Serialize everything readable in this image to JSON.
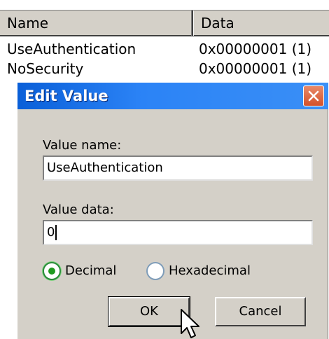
{
  "list": {
    "columns": [
      "Name",
      "Data"
    ],
    "rows": [
      {
        "name": "UseAuthentication",
        "data": "0x00000001 (1)"
      },
      {
        "name": "NoSecurity",
        "data": "0x00000001 (1)"
      }
    ]
  },
  "dialog": {
    "title": "Edit Value",
    "value_name_label": "Value name:",
    "value_name": "UseAuthentication",
    "value_data_label": "Value data:",
    "value_data": "0",
    "radios": [
      {
        "label": "Decimal",
        "selected": true
      },
      {
        "label": "Hexadecimal",
        "selected": false
      }
    ],
    "ok_label": "OK",
    "cancel_label": "Cancel"
  },
  "colors": {
    "titlebar": "#2b83f6",
    "dialog_bg": "#d4d0c8",
    "radio_selected": "#1f9a1f",
    "close_button": "#d4522a"
  }
}
